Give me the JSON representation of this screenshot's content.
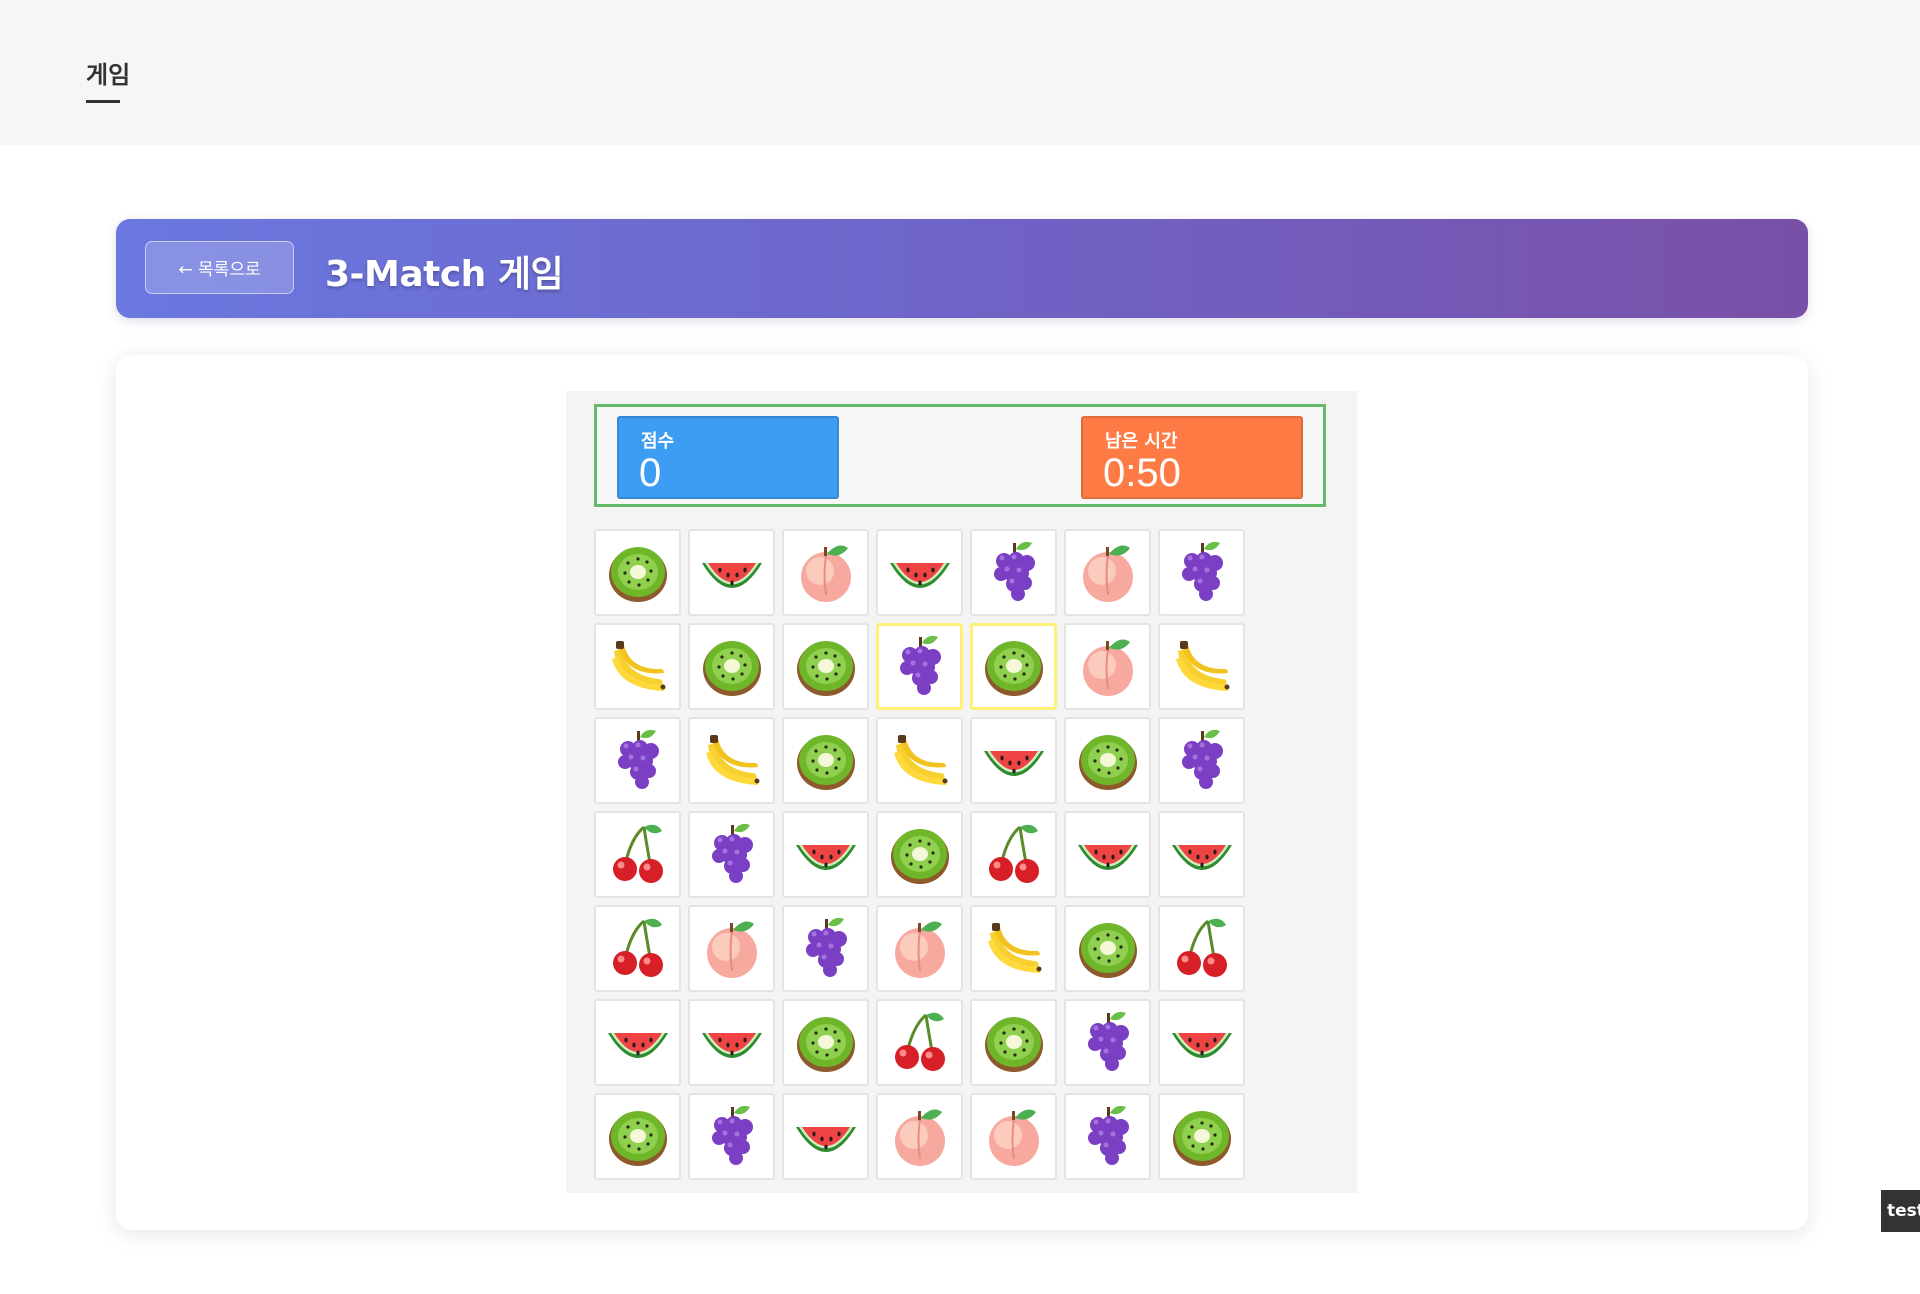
{
  "nav": {
    "active_tab": "게임"
  },
  "header": {
    "back_label": "← 목록으로",
    "title": "3-Match 게임",
    "colors": {
      "gradient_start": "#6a78e0",
      "gradient_end": "#7950a8"
    }
  },
  "hud": {
    "score_label": "점수",
    "score_value": "0",
    "time_label": "남은 시간",
    "time_value": "0:50",
    "colors": {
      "score": "#3d9df2",
      "time": "#ff7b45",
      "frame": "#66bb6a"
    }
  },
  "board": {
    "rows": [
      [
        "kiwi",
        "watermelon",
        "peach",
        "watermelon",
        "grapes",
        "peach",
        "grapes"
      ],
      [
        "banana",
        "kiwi",
        "kiwi",
        "grapes",
        "kiwi",
        "peach",
        "banana"
      ],
      [
        "grapes",
        "banana",
        "kiwi",
        "banana",
        "watermelon",
        "kiwi",
        "grapes"
      ],
      [
        "cherry",
        "grapes",
        "watermelon",
        "kiwi",
        "cherry",
        "watermelon",
        "watermelon"
      ],
      [
        "cherry",
        "peach",
        "grapes",
        "peach",
        "banana",
        "kiwi",
        "cherry"
      ],
      [
        "watermelon",
        "watermelon",
        "kiwi",
        "cherry",
        "kiwi",
        "grapes",
        "watermelon"
      ],
      [
        "kiwi",
        "grapes",
        "watermelon",
        "peach",
        "peach",
        "grapes",
        "kiwi"
      ]
    ],
    "selected": [
      [
        1,
        3
      ],
      [
        1,
        4
      ]
    ],
    "selected_color": "#fff176"
  },
  "corner_badge": "test"
}
